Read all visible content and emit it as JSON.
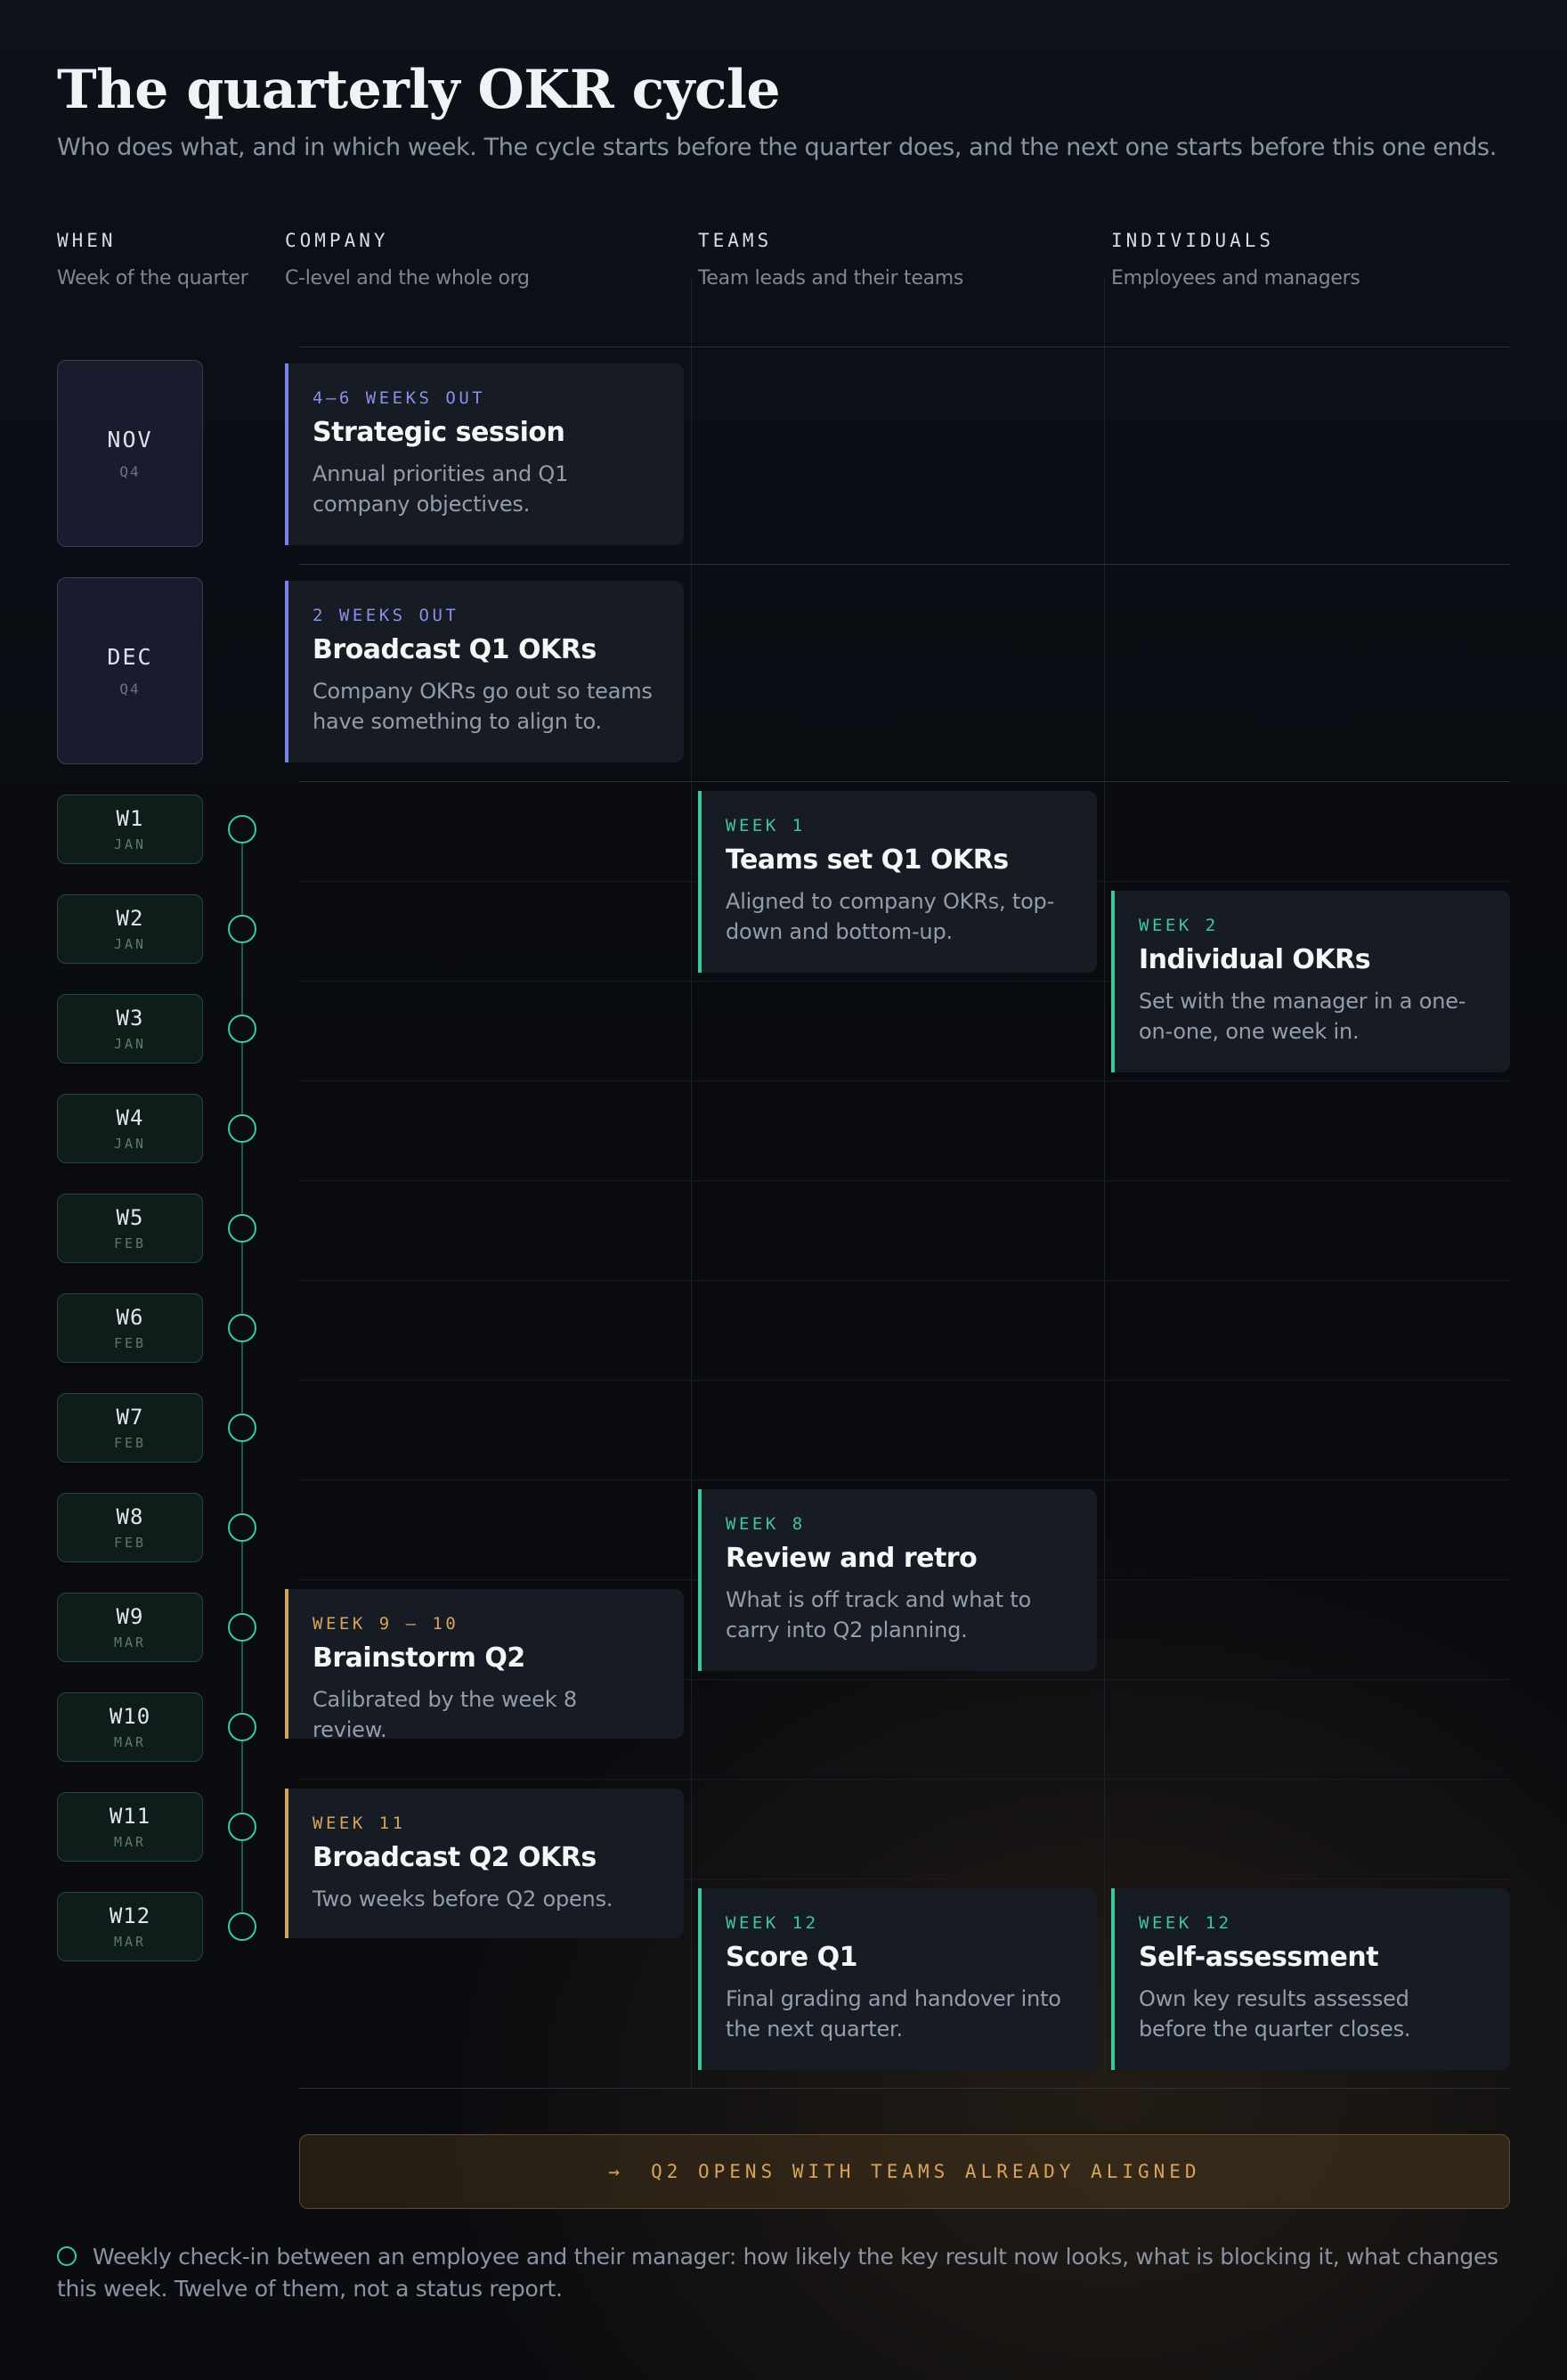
{
  "header": {
    "title": "The quarterly OKR cycle",
    "subtitle": "Who does what, and in which week. The cycle starts before the quarter does, and the next one starts before this one ends."
  },
  "columns": [
    {
      "heading": "WHEN",
      "sub": "Week of the quarter"
    },
    {
      "heading": "COMPANY",
      "sub": "C-level and the whole org"
    },
    {
      "heading": "TEAMS",
      "sub": "Team leads and their teams"
    },
    {
      "heading": "INDIVIDUALS",
      "sub": "Employees and managers"
    }
  ],
  "months": [
    {
      "label": "NOV",
      "quarter": "Q4"
    },
    {
      "label": "DEC",
      "quarter": "Q4"
    }
  ],
  "weeks": [
    {
      "label": "W1",
      "month": "JAN"
    },
    {
      "label": "W2",
      "month": "JAN"
    },
    {
      "label": "W3",
      "month": "JAN"
    },
    {
      "label": "W4",
      "month": "JAN"
    },
    {
      "label": "W5",
      "month": "FEB"
    },
    {
      "label": "W6",
      "month": "FEB"
    },
    {
      "label": "W7",
      "month": "FEB"
    },
    {
      "label": "W8",
      "month": "FEB"
    },
    {
      "label": "W9",
      "month": "MAR"
    },
    {
      "label": "W10",
      "month": "MAR"
    },
    {
      "label": "W11",
      "month": "MAR"
    },
    {
      "label": "W12",
      "month": "MAR"
    }
  ],
  "cards": {
    "strategic": {
      "label": "4–6 WEEKS OUT",
      "title": "Strategic session",
      "desc": "Annual priorities and Q1 company objectives."
    },
    "broadcast_q1": {
      "label": "2 WEEKS OUT",
      "title": "Broadcast Q1 OKRs",
      "desc": "Company OKRs go out so teams have something to align to."
    },
    "teams_set": {
      "label": "WEEK 1",
      "title": "Teams set Q1 OKRs",
      "desc": "Aligned to company OKRs, top-down and bottom-up."
    },
    "individual": {
      "label": "WEEK 2",
      "title": "Individual OKRs",
      "desc": "Set with the manager in a one-on-one, one week in."
    },
    "review": {
      "label": "WEEK 8",
      "title": "Review and retro",
      "desc": "What is off track and what to carry into Q2 planning."
    },
    "brainstorm": {
      "label": "WEEK 9 – 10",
      "title": "Brainstorm Q2",
      "desc": "Calibrated by the week 8 review."
    },
    "broadcast_q2": {
      "label": "WEEK 11",
      "title": "Broadcast Q2 OKRs",
      "desc": "Two weeks before Q2 opens."
    },
    "score": {
      "label": "WEEK 12",
      "title": "Score Q1",
      "desc": "Final grading and handover into the next quarter."
    },
    "self": {
      "label": "WEEK 12",
      "title": "Self-assessment",
      "desc": "Own key results assessed before the quarter closes."
    }
  },
  "banner": {
    "arrow": "→",
    "text": "Q2 OPENS WITH TEAMS ALREADY ALIGNED"
  },
  "footnote": "Weekly check-in between an employee and their manager: how likely the key result now looks, what is blocking it, what changes this week. Twelve of them, not a status report.",
  "colors": {
    "company": "#7a82e8",
    "teams": "#3fc79a",
    "next_quarter": "#d8a45c"
  },
  "icons": {
    "checkin": "circle-outline-icon",
    "banner": "arrow-right-icon"
  }
}
